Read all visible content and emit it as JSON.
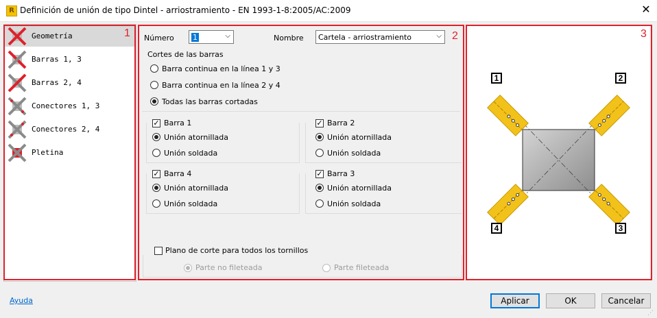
{
  "window": {
    "title": "Definición de unión de tipo Dintel - arriostramiento  - EN 1993-1-8:2005/AC:2009",
    "app_icon": "R"
  },
  "list": {
    "items": [
      {
        "label": "Geometría",
        "selected": true,
        "icon": "geometry-cross-icon"
      },
      {
        "label": "Barras 1, 3",
        "selected": false,
        "icon": "bars-cross-icon"
      },
      {
        "label": "Barras 2, 4",
        "selected": false,
        "icon": "bars-cross-icon"
      },
      {
        "label": "Conectores 1, 3",
        "selected": false,
        "icon": "connectors-cross-icon"
      },
      {
        "label": "Conectores 2, 4",
        "selected": false,
        "icon": "connectors-cross-icon"
      },
      {
        "label": "Pletina",
        "selected": false,
        "icon": "plate-cross-icon"
      }
    ]
  },
  "zones": {
    "one": "1",
    "two": "2",
    "three": "3"
  },
  "form": {
    "numero_label": "Número",
    "numero_value": "1",
    "nombre_label": "Nombre",
    "nombre_value": "Cartela - arriostramiento",
    "cortes_title": "Cortes de las barras",
    "cortes_options": [
      {
        "label": "Barra continua en la línea 1 y 3",
        "checked": false
      },
      {
        "label": "Barra continua en la línea 2 y 4",
        "checked": false
      },
      {
        "label": "Todas las barras cortadas",
        "checked": true
      }
    ],
    "barras": [
      {
        "title": "Barra 1",
        "checked": true,
        "opt1": "Unión atornillada",
        "opt2": "Unión soldada",
        "selected": 1
      },
      {
        "title": "Barra 2",
        "checked": true,
        "opt1": "Unión atornillada",
        "opt2": "Unión soldada",
        "selected": 1
      },
      {
        "title": "Barra 4",
        "checked": true,
        "opt1": "Unión atornillada",
        "opt2": "Unión soldada",
        "selected": 1
      },
      {
        "title": "Barra 3",
        "checked": true,
        "opt1": "Unión atornillada",
        "opt2": "Unión soldada",
        "selected": 1
      }
    ],
    "plano_label": "Plano de corte para todos los tornillos",
    "plano_checked": false,
    "parte_no": "Parte no fileteada",
    "parte_si": "Parte fileteada"
  },
  "preview": {
    "labels": {
      "tl": "1",
      "tr": "2",
      "bl": "4",
      "br": "3"
    },
    "colors": {
      "plate": "#a8a8a8",
      "bar": "#f2c21b",
      "bar_edge": "#c99a00"
    }
  },
  "footer": {
    "help": "Ayuda",
    "apply": "Aplicar",
    "ok": "OK",
    "cancel": "Cancelar"
  },
  "colors": {
    "highlight": "#e0202a",
    "link": "#0066cc",
    "accent": "#0078d7"
  }
}
